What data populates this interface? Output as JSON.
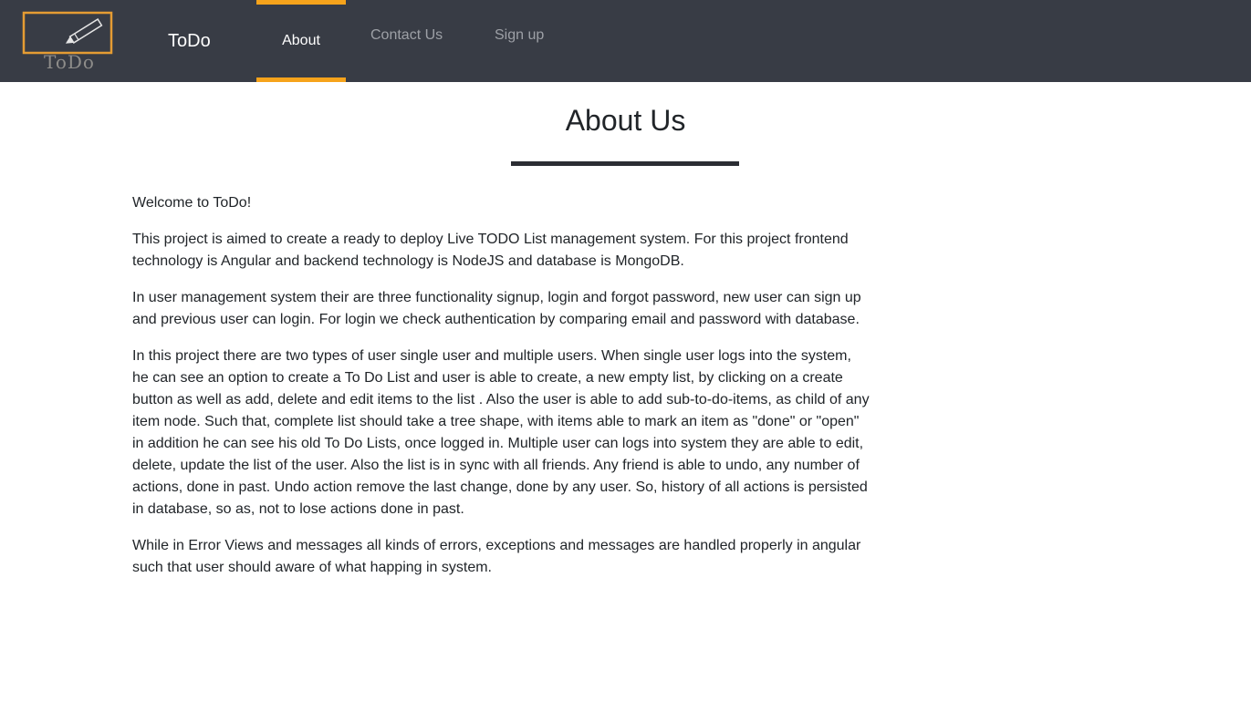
{
  "header": {
    "logo_text": "ToDo",
    "brand": "ToDo",
    "nav": {
      "about": "About",
      "contact": "Contact Us",
      "signup": "Sign up"
    },
    "colors": {
      "background": "#383c45",
      "accent": "#f6a31b"
    }
  },
  "main": {
    "title": "About Us",
    "paragraphs": [
      "Welcome to ToDo!",
      "This project is aimed to create a ready to deploy Live TODO List management system. For this project frontend technology is Angular and backend technology is NodeJS and database is MongoDB.",
      "In user management system their are three functionality signup, login and forgot password, new user can sign up and previous user can login. For login we check authentication by comparing email and password with database.",
      "In this project there are two types of user single user and multiple users. When single user logs into the system, he can see an option to create a To Do List and user is able to create, a new empty list, by clicking on a create button as well as add, delete and edit items to the list . Also the user is able to add sub-to-do-items, as child of any item node. Such that, complete list should take a tree shape, with items able to mark an item as \"done\" or \"open\" in addition he can see his old To Do Lists, once logged in. Multiple user can logs into system they are able to edit, delete, update the list of the user. Also the list is in sync with all friends. Any friend is able to undo, any number of actions, done in past. Undo action remove the last change, done by any user. So, history of all actions is persisted in database, so as, not to lose actions done in past.",
      "While in Error Views and messages all kinds of errors, exceptions and messages are handled properly in angular such that user should aware of what happing in system."
    ]
  }
}
